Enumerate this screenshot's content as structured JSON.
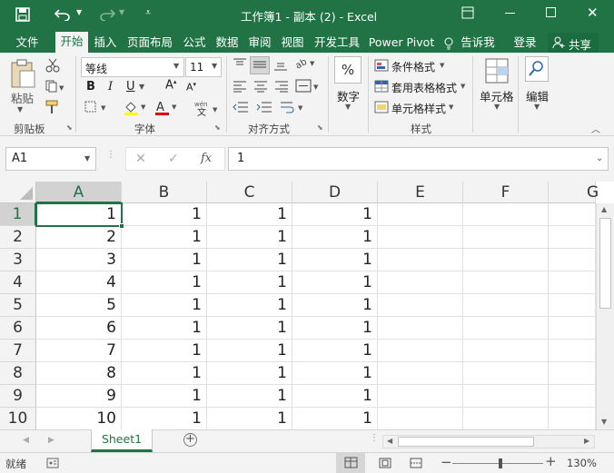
{
  "window": {
    "title": "工作簿1 - 副本 (2)  -  Excel"
  },
  "menu": {
    "file": "文件",
    "home": "开始",
    "insert": "插入",
    "layout": "页面布局",
    "formulas": "公式",
    "data": "数据",
    "review": "审阅",
    "view": "视图",
    "developer": "开发工具",
    "powerpivot": "Power Pivot",
    "tellme": "告诉我",
    "login": "登录",
    "share": "共享"
  },
  "ribbon": {
    "clipboard": {
      "paste": "粘贴",
      "label": "剪贴板"
    },
    "font": {
      "name": "等线",
      "size": "11",
      "label": "字体",
      "bold": "B",
      "italic": "I",
      "underline": "U"
    },
    "alignment": {
      "label": "对齐方式"
    },
    "number": {
      "label": "数字"
    },
    "styles": {
      "conditional": "条件格式",
      "table": "套用表格格式",
      "cell": "单元格样式",
      "label": "样式"
    },
    "cells": {
      "label": "单元格"
    },
    "editing": {
      "label": "编辑"
    }
  },
  "formula_bar": {
    "name_box": "A1",
    "value": "1",
    "fx": "fx"
  },
  "sheet": {
    "columns": [
      "A",
      "B",
      "C",
      "D",
      "E",
      "F",
      "G"
    ],
    "rows": [
      {
        "num": "1",
        "A": "1",
        "B": "1",
        "C": "1",
        "D": "1"
      },
      {
        "num": "2",
        "A": "2",
        "B": "1",
        "C": "1",
        "D": "1"
      },
      {
        "num": "3",
        "A": "3",
        "B": "1",
        "C": "1",
        "D": "1"
      },
      {
        "num": "4",
        "A": "4",
        "B": "1",
        "C": "1",
        "D": "1"
      },
      {
        "num": "5",
        "A": "5",
        "B": "1",
        "C": "1",
        "D": "1"
      },
      {
        "num": "6",
        "A": "6",
        "B": "1",
        "C": "1",
        "D": "1"
      },
      {
        "num": "7",
        "A": "7",
        "B": "1",
        "C": "1",
        "D": "1"
      },
      {
        "num": "8",
        "A": "8",
        "B": "1",
        "C": "1",
        "D": "1"
      },
      {
        "num": "9",
        "A": "9",
        "B": "1",
        "C": "1",
        "D": "1"
      },
      {
        "num": "10",
        "A": "10",
        "B": "1",
        "C": "1",
        "D": "1"
      }
    ]
  },
  "tabs": {
    "sheet1": "Sheet1"
  },
  "status": {
    "ready": "就绪",
    "zoom": "130%"
  },
  "colors": {
    "accent": "#217346"
  }
}
